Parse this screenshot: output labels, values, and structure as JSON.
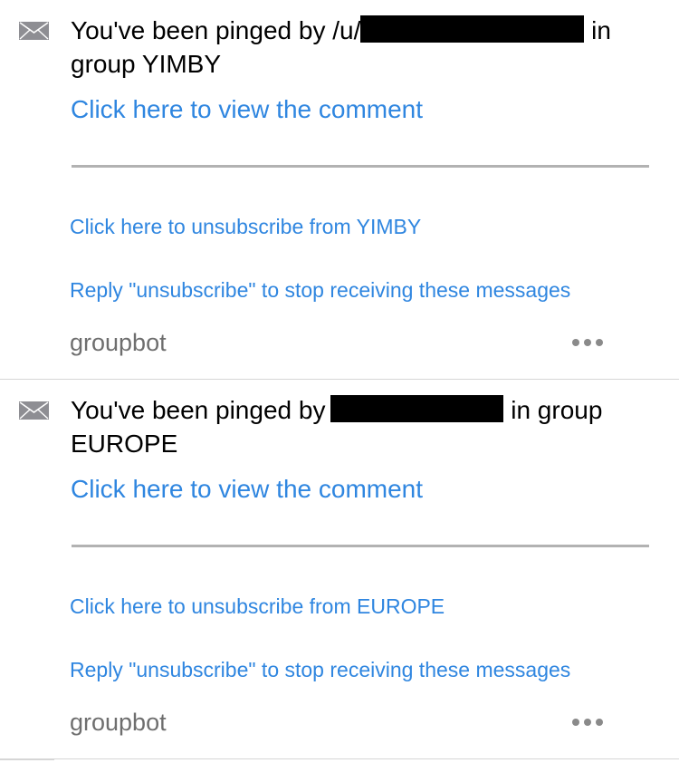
{
  "messages": [
    {
      "title_prefix": "You've been pinged by /u/",
      "title_suffix": "in",
      "title_line2": "group YIMBY",
      "view_link": "Click here to view the comment",
      "unsubscribe_link": "Click here to unsubscribe from YIMBY",
      "reply_note": "Reply \"unsubscribe\" to stop receiving these messages",
      "author": "groupbot"
    },
    {
      "title_prefix": "You've been pinged by",
      "title_suffix": "in group",
      "title_line2": "EUROPE",
      "view_link": "Click here to view the comment",
      "unsubscribe_link": "Click here to unsubscribe from EUROPE",
      "reply_note": "Reply \"unsubscribe\" to stop receiving these messages",
      "author": "groupbot"
    }
  ],
  "icons": {
    "message_icon": "envelope-icon",
    "more_icon": "more-options-icon"
  },
  "colors": {
    "link": "#2f86e0",
    "author": "#6e6e6e",
    "divider": "#b2b2b2",
    "redaction": "#000000"
  }
}
